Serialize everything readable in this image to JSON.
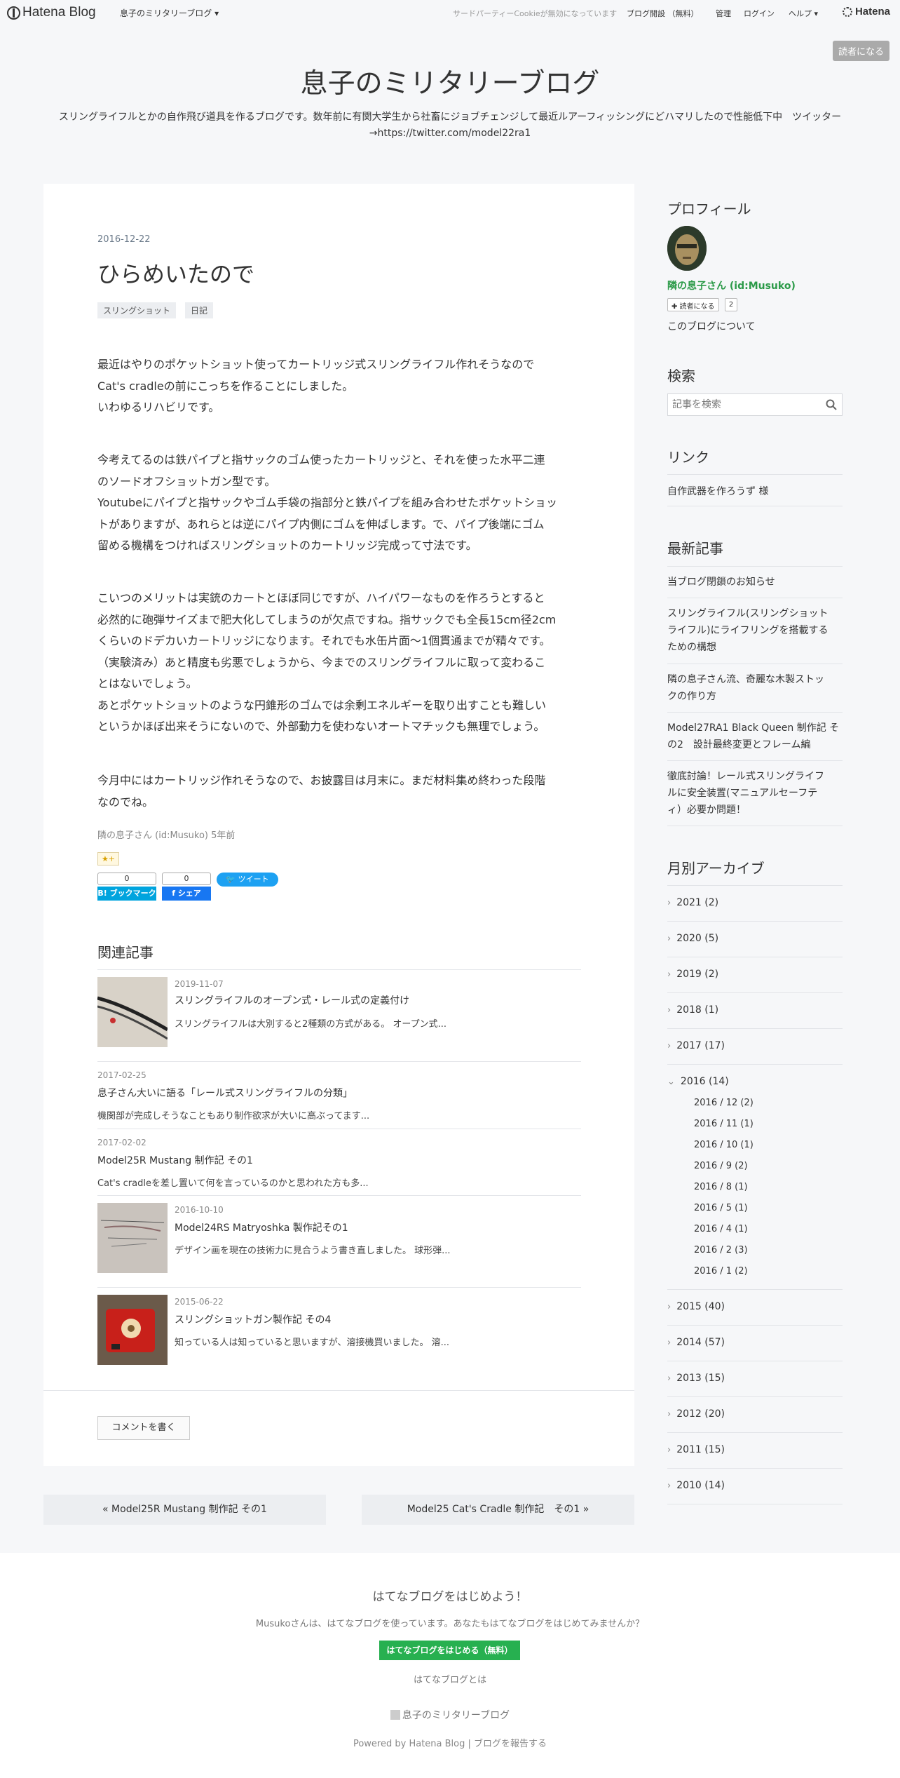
{
  "header": {
    "logo_text": "Hatena Blog",
    "blog_menu": "息子のミリタリーブログ ▾",
    "cookie_note": "サードパーティーCookieが無効になっています",
    "open_blog": "ブログ開設 （無料）",
    "manage": "管理",
    "login": "ログイン",
    "help": "ヘルプ ▾",
    "brand": "Hatena",
    "subscribe": "読者になる"
  },
  "blog": {
    "title": "息子のミリタリーブログ",
    "description": "スリングライフルとかの自作飛び道具を作るブログです。数年前に有関大学生から社畜にジョブチェンジして最近ルアーフィッシングにどハマリしたので性能低下中　ツイッター→https://twitter.com/model22ra1"
  },
  "entry": {
    "date": "2016-12-22",
    "title": "ひらめいたので",
    "categories": [
      "スリングショット",
      "日記"
    ],
    "paragraphs": [
      [
        "最近はやりのポケットショット使ってカートリッジ式スリングライフル作れそうなので",
        "Cat's cradleの前にこっちを作ることにしました。",
        "いわゆるリハビリです。"
      ],
      [
        "今考えてるのは鉄パイプと指サックのゴム使ったカートリッジと、それを使った水平二連",
        "のソードオフショットガン型です。",
        "Youtubeにパイプと指サックやゴム手袋の指部分と鉄パイプを組み合わせたポケットショッ",
        "トがありますが、あれらとは逆にパイプ内側にゴムを伸ばします。で、パイプ後端にゴム",
        "留める機構をつければスリングショットのカートリッジ完成って寸法です。"
      ],
      [
        "こいつのメリットは実銃のカートとほぼ同じですが、ハイパワーなものを作ろうとすると",
        "必然的に砲弾サイズまで肥大化してしまうのが欠点ですね。指サックでも全長15cm径2cm",
        "くらいのドデカいカートリッジになります。それでも水缶片面〜1個貫通までが精々です。",
        "（実験済み）あと精度も劣悪でしょうから、今までのスリングライフルに取って変わるこ",
        "とはないでしょう。",
        "あとポケットショットのような円錐形のゴムでは余剰エネルギーを取り出すことも難しい",
        "というかほぼ出来そうにないので、外部動力を使わないオートマチックも無理でしょう。"
      ],
      [
        "今月中にはカートリッジ作れそうなので、お披露目は月末に。まだ材料集め終わった段階",
        "なのでね。"
      ]
    ],
    "footer": "隣の息子さん (id:Musuko) 5年前",
    "star_label": "★+",
    "share": {
      "hatebu_count": "0",
      "hatebu_label": "B! ブックマーク",
      "fb_count": "0",
      "fb_label": "f シェア",
      "tweet_label": "ツイート"
    }
  },
  "related": {
    "heading": "関連記事",
    "items": [
      {
        "date": "2019-11-07",
        "title": "スリングライフルのオープン式・レール式の定義付け",
        "snippet": "スリングライフルは大別すると2種類の方式がある。 オープン式..."
      },
      {
        "date": "2017-02-25",
        "title": "息子さん大いに語る「レール式スリングライフルの分類」",
        "snippet": "機関部が完成しそうなこともあり制作欲求が大いに高ぶってます..."
      },
      {
        "date": "2017-02-02",
        "title": "Model25R Mustang 制作記 その1",
        "snippet": "Cat's cradleを差し置いて何を言っているのかと思われた方も多..."
      },
      {
        "date": "2016-10-10",
        "title": "Model24RS Matryoshka 製作記その1",
        "snippet": "デザイン画を現在の技術力に見合うよう書き直しました。 球形弾..."
      },
      {
        "date": "2015-06-22",
        "title": "スリングショットガン製作記 その4",
        "snippet": "知っている人は知っていると思いますが、溶接機買いました。 溶..."
      }
    ]
  },
  "comment_button": "コメントを書く",
  "pager": {
    "prev": "« Model25R Mustang 制作記 その1",
    "next": "Model25 Cat's Cradle 制作記　その1 »"
  },
  "sidebar": {
    "profile_heading": "プロフィール",
    "author": "隣の息子さん (id:Musuko)",
    "reader_button": "✚ 読者になる",
    "reader_count": "2",
    "about": "このブログについて",
    "search_heading": "検索",
    "search_placeholder": "記事を検索",
    "links_heading": "リンク",
    "link_item": "自作武器を作ろうず 様",
    "recent_heading": "最新記事",
    "recent": [
      [
        "当ブログ閉鎖のお知らせ"
      ],
      [
        "スリングライフル(スリングショット",
        "ライフル)にライフリングを搭載する",
        "ための構想"
      ],
      [
        "隣の息子さん流、奇麗な木製ストッ",
        "クの作り方"
      ],
      [
        "Model27RA1 Black Queen 制作記 そ",
        "の2　設計最終変更とフレーム編"
      ],
      [
        "徹底討論！レール式スリングライフ",
        "ルに安全装置(マニュアルセーフテ",
        "ィ）必要か問題！"
      ]
    ],
    "archive_heading": "月別アーカイブ",
    "years": [
      "2021 (2)",
      "2020 (5)",
      "2019 (2)",
      "2018 (1)",
      "2017 (17)",
      "2016 (14)",
      "2015 (40)",
      "2014 (57)",
      "2013 (15)",
      "2012 (20)",
      "2011 (15)",
      "2010 (14)"
    ],
    "months_2016": [
      "2016 / 12 (2)",
      "2016 / 11 (1)",
      "2016 / 10 (1)",
      "2016 / 9 (2)",
      "2016 / 8 (1)",
      "2016 / 5 (1)",
      "2016 / 4 (1)",
      "2016 / 2 (3)",
      "2016 / 1 (2)"
    ]
  },
  "footer": {
    "title": "はてなブログをはじめよう！",
    "message": "Musukoさんは、はてなブログを使っています。あなたもはてなブログをはじめてみませんか？",
    "start_button": "はてなブログをはじめる（無料）",
    "about": "はてなブログとは",
    "blog_name": "息子のミリタリーブログ",
    "powered": "Powered by Hatena Blog | ブログを報告する"
  },
  "colors": {
    "accent_green": "#27b050",
    "author_green": "#2b9a48",
    "hatebu_blue": "#00a4de",
    "facebook_blue": "#1877f2",
    "twitter_blue": "#1da1f2"
  }
}
